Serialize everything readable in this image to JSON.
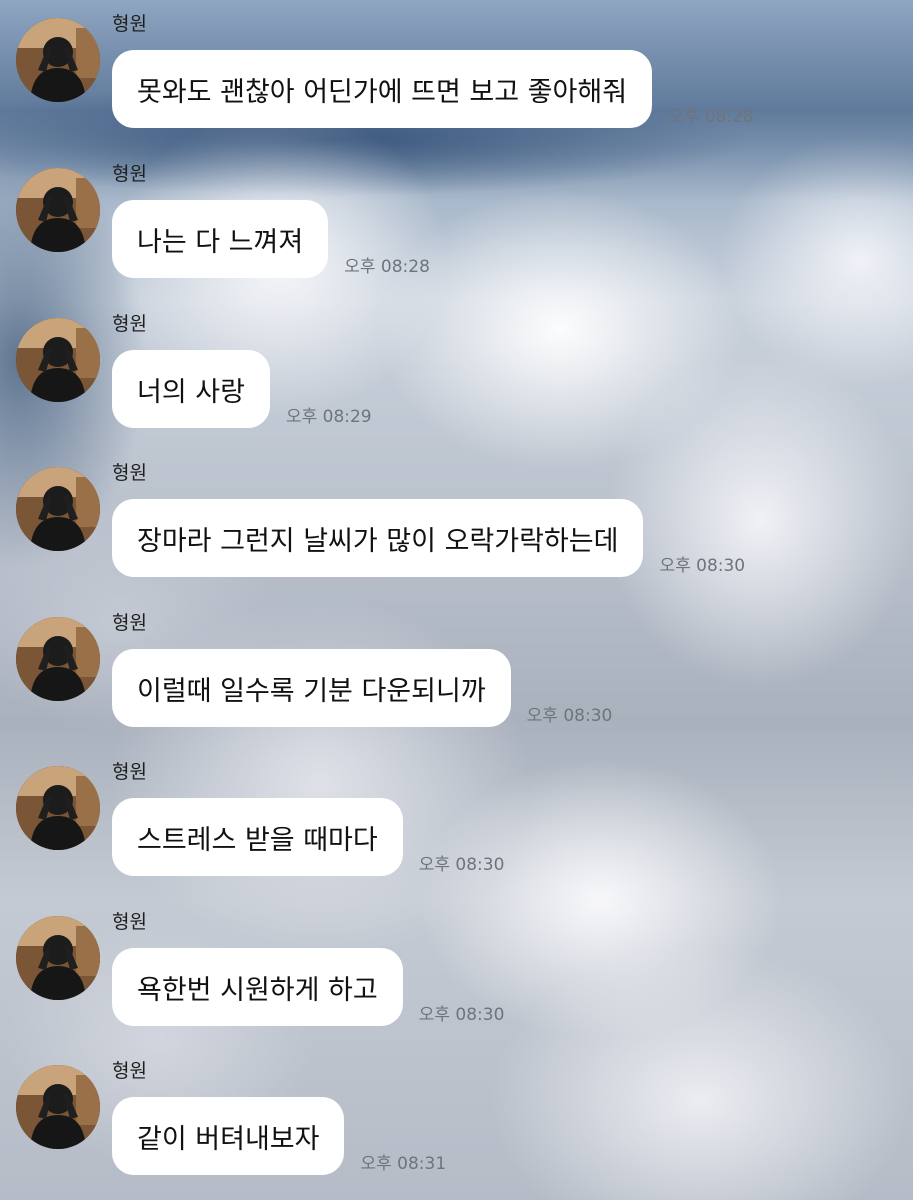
{
  "chat": {
    "messages": [
      {
        "sender": "형원",
        "text": "못와도 괜찮아 어딘가에 뜨면 보고 좋아해줘",
        "time": "오후 08:28"
      },
      {
        "sender": "형원",
        "text": "나는 다 느껴져",
        "time": "오후 08:28"
      },
      {
        "sender": "형원",
        "text": "너의 사랑",
        "time": "오후 08:29"
      },
      {
        "sender": "형원",
        "text": "장마라 그런지 날씨가 많이 오락가락하는데",
        "time": "오후 08:30"
      },
      {
        "sender": "형원",
        "text": "이럴때 일수록 기분 다운되니까",
        "time": "오후 08:30"
      },
      {
        "sender": "형원",
        "text": "스트레스 받을 때마다",
        "time": "오후 08:30"
      },
      {
        "sender": "형원",
        "text": "욕한번 시원하게 하고",
        "time": "오후 08:30"
      },
      {
        "sender": "형원",
        "text": "같이 버텨내보자",
        "time": "오후 08:31"
      }
    ]
  },
  "colors": {
    "bubble": "#ffffff",
    "text": "#111111",
    "timestamp": "#6f747c"
  }
}
